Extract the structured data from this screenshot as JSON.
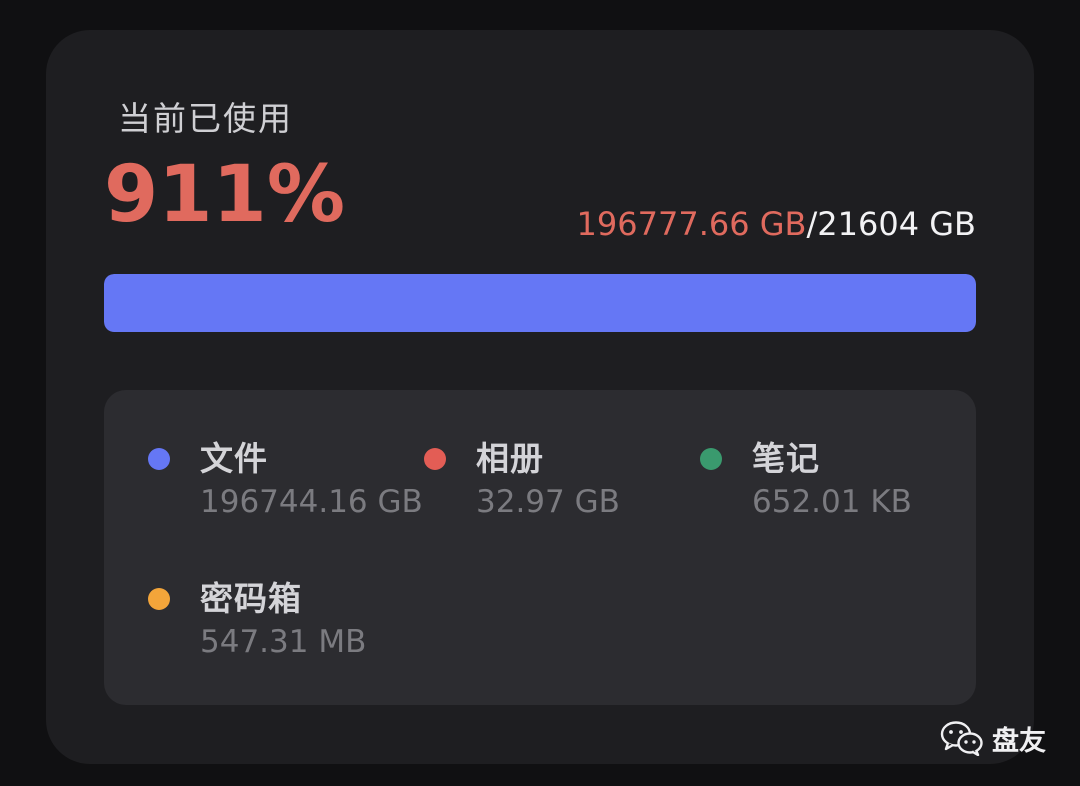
{
  "storage": {
    "title": "当前已使用",
    "percent": "911%",
    "used": "196777.66 GB",
    "separator": "/",
    "total": "21604 GB",
    "progress_fraction": 1.0,
    "bar_color": "#6577f5",
    "accent_color": "#e06a5e"
  },
  "breakdown": {
    "items": [
      {
        "label": "文件",
        "value": "196744.16 GB",
        "color": "#6577f5"
      },
      {
        "label": "相册",
        "value": "32.97 GB",
        "color": "#e35d55"
      },
      {
        "label": "笔记",
        "value": "652.01 KB",
        "color": "#3a9a6e"
      },
      {
        "label": "密码箱",
        "value": "547.31 MB",
        "color": "#f3a53a"
      }
    ]
  },
  "watermark": {
    "icon": "wechat-icon",
    "text": "盘友"
  }
}
